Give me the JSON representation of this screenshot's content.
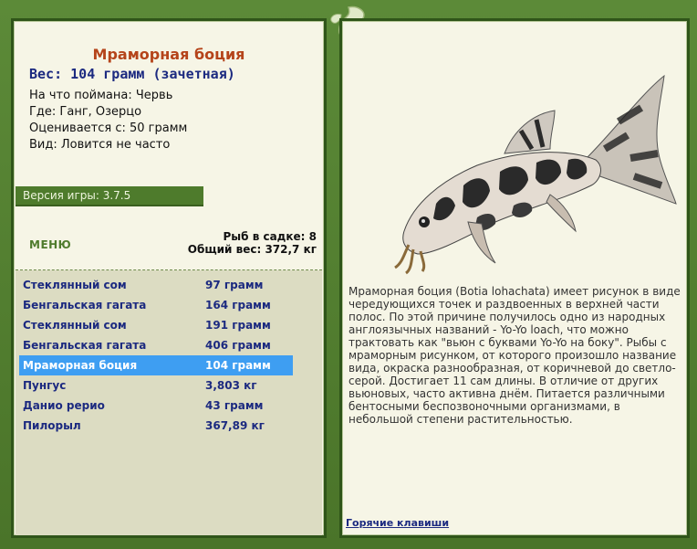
{
  "fish": {
    "name": "Мраморная боция",
    "weight_line": "Вес: 104 грамм (зачетная)",
    "bait_line": "На что поймана: Червь",
    "place_line": "Где: Ганг, Озерцо",
    "rated_line": "Оценивается с: 50 грамм",
    "kind_line": "Вид: Ловится не часто",
    "description": "Мраморная боция (Botia lohachata) имеет рисунок в виде чередующихся точек и раздвоенных в верхней части полос. По этой причине получилось одно из народных англоязычных названий - Yo-Yo loach, что можно трактовать как \"вьюн с буквами Yo-Yo на боку\". Рыбы с мраморным рисунком, от которого произошло название вида, окраска разнообразная, от коричневой до светло-серой. Достигает 11 сам длины. В отличие от других вьюновых, часто активна днём. Питается различными бентосными беспозвоночными организмами, в небольшой степени растительностью."
  },
  "game": {
    "version": "Версия игры: 3.7.5",
    "menu_label": "МЕНЮ",
    "cage_count": "Рыб в садке: 8",
    "total_weight": "Общий вес: 372,7 кг",
    "hotkeys": "Горячие клавиши"
  },
  "catches": [
    {
      "name": "Стеклянный сом",
      "weight": "97 грамм",
      "selected": false
    },
    {
      "name": "Бенгальская гагата",
      "weight": "164 грамм",
      "selected": false
    },
    {
      "name": "Стеклянный сом",
      "weight": "191 грамм",
      "selected": false
    },
    {
      "name": "Бенгальская гагата",
      "weight": "406 грамм",
      "selected": false
    },
    {
      "name": "Мраморная боция",
      "weight": "104 грамм",
      "selected": true
    },
    {
      "name": "Пунгус",
      "weight": "3,803 кг",
      "selected": false
    },
    {
      "name": "Данио рерио",
      "weight": "43 грамм",
      "selected": false
    },
    {
      "name": "Пилорыл",
      "weight": "367,89 кг",
      "selected": false
    }
  ],
  "colors": {
    "frame_green": "#4e7b2c",
    "title_orange": "#b5441a",
    "text_navy": "#1c2a80",
    "selection_blue": "#3e9ef2"
  }
}
